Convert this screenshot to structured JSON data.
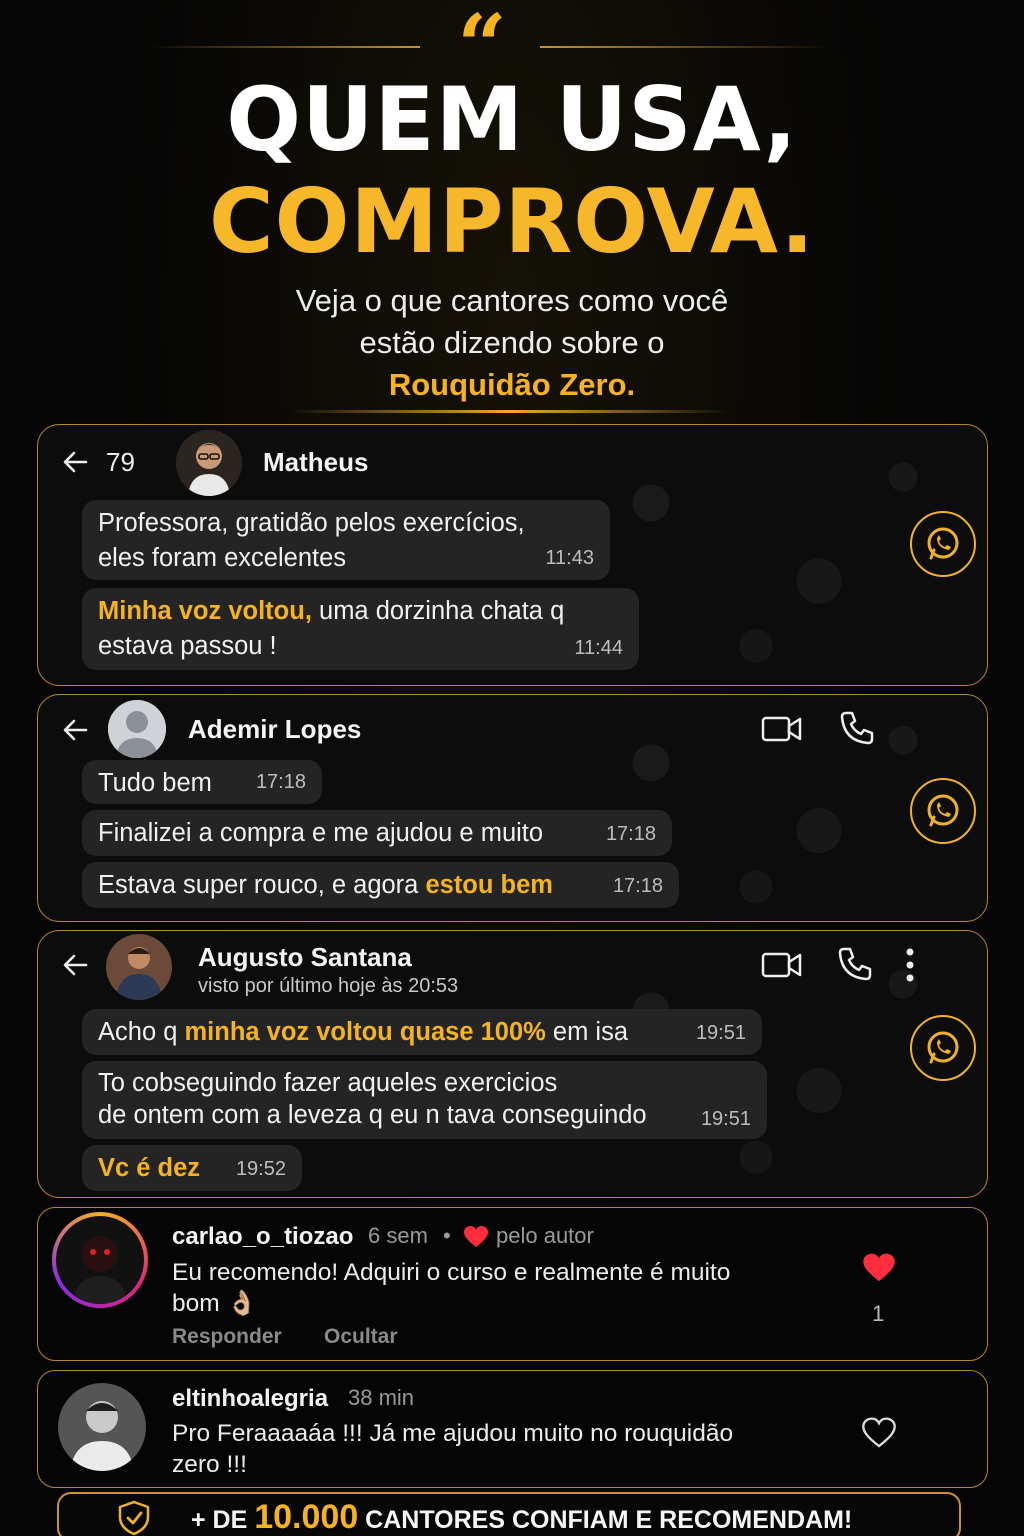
{
  "header": {
    "quote_mark": "“",
    "title_line1": "QUEM USA,",
    "title_line2": "COMPROVA.",
    "subtitle_line1": "Veja o que cantores como você",
    "subtitle_line2": "estão dizendo sobre o",
    "subtitle_brand": "Rouquidão Zero."
  },
  "chats": [
    {
      "unread_count": "79",
      "contact": "Matheus",
      "messages": [
        {
          "pre": "Professora, gratidão pelos exercícios,",
          "line2": "eles foram excelentes",
          "time": "11:43"
        },
        {
          "highlight": "Minha voz voltou,",
          "post": " uma dorzinha chata q",
          "line2": "estava passou !",
          "time": "11:44"
        }
      ]
    },
    {
      "contact": "Ademir Lopes",
      "messages": [
        {
          "pre": "Tudo bem",
          "time": "17:18"
        },
        {
          "pre": "Finalizei a compra e me ajudou e muito",
          "time": "17:18"
        },
        {
          "pre": "Estava super rouco, e agora ",
          "highlight": "estou bem",
          "time": "17:18"
        }
      ]
    },
    {
      "contact": "Augusto Santana",
      "status": "visto por último hoje às 20:53",
      "messages": [
        {
          "pre": "Acho q ",
          "highlight": "minha voz voltou quase 100%",
          "post": " em isa",
          "time": "19:51"
        },
        {
          "pre": "To cobseguindo fazer aqueles exercicios",
          "line2": "de ontem com a leveza q eu n tava conseguindo",
          "time": "19:51"
        },
        {
          "highlight": "Vc é dez",
          "time": "19:52"
        }
      ]
    }
  ],
  "comments": [
    {
      "user": "carlao_o_tiozao",
      "time": "6 sem",
      "dot": "•",
      "liked_by_author": "pelo autor",
      "text_line1": "Eu recomendo! Adquiri o curso e realmente é muito",
      "text_line2": "bom 👌🏼",
      "reply": "Responder",
      "hide": "Ocultar",
      "likes": "1"
    },
    {
      "user": "eltinhoalegria",
      "time": "38 min",
      "text_line1": "Pro Feraaaaáa !!! Já me ajudou muito no rouquidão",
      "text_line2": "zero !!!"
    }
  ],
  "footer": {
    "prefix": "+ DE ",
    "number": "10.000",
    "suffix": " CANTORES CONFIAM E RECOMENDAM!"
  },
  "colors": {
    "accent": "#f5b322",
    "card_border": "#b8862a",
    "bubble": "#242424",
    "heart": "#ff2d3d"
  },
  "icons": [
    "back-arrow-icon",
    "whatsapp-icon",
    "video-call-icon",
    "phone-icon",
    "more-vertical-icon",
    "heart-icon",
    "shield-check-icon"
  ]
}
